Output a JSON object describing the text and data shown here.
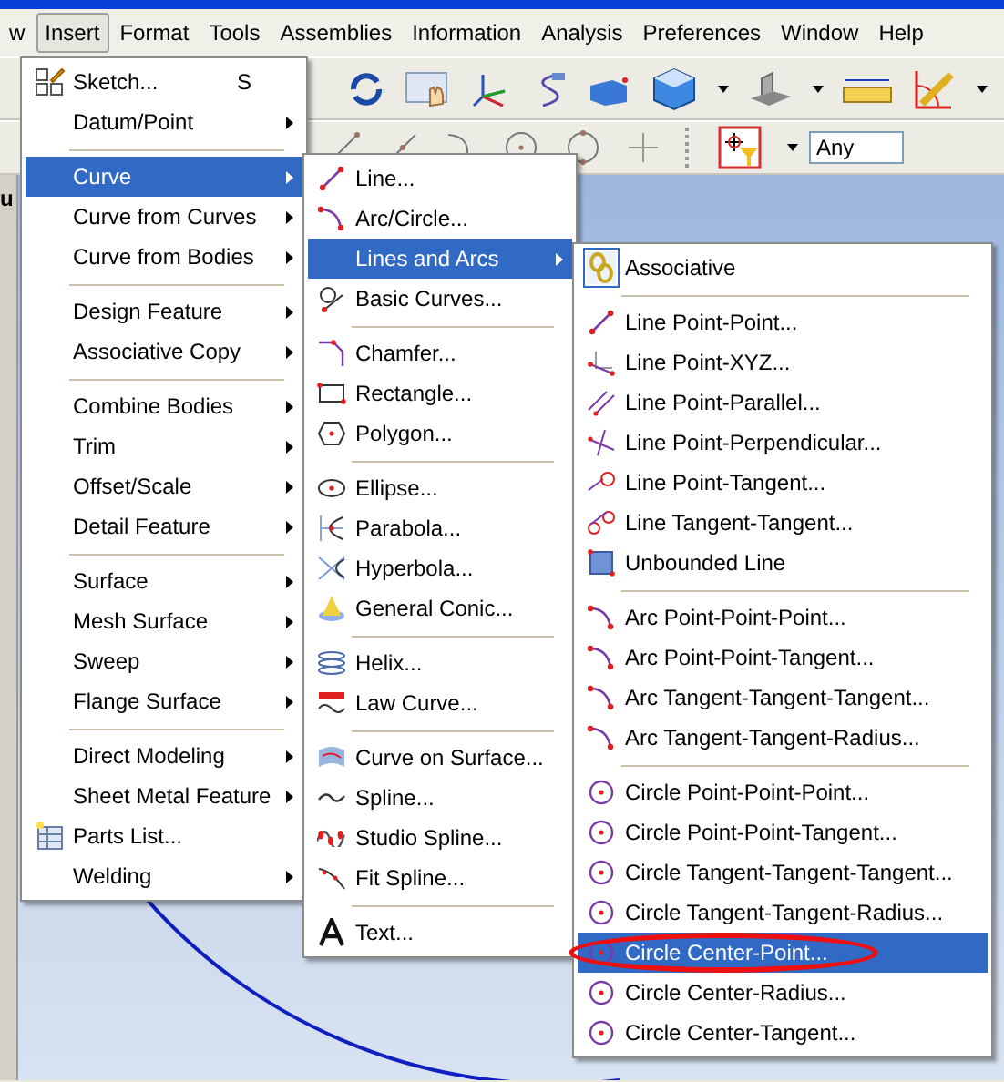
{
  "menubar": [
    {
      "label": "w",
      "selected": false
    },
    {
      "label": "Insert",
      "selected": true
    },
    {
      "label": "Format",
      "selected": false
    },
    {
      "label": "Tools",
      "selected": false
    },
    {
      "label": "Assemblies",
      "selected": false
    },
    {
      "label": "Information",
      "selected": false
    },
    {
      "label": "Analysis",
      "selected": false
    },
    {
      "label": "Preferences",
      "selected": false
    },
    {
      "label": "Window",
      "selected": false
    },
    {
      "label": "Help",
      "selected": false
    }
  ],
  "side_label": "u",
  "toolbar": {
    "selection_filter": {
      "value": "Any"
    }
  },
  "insert_menu": {
    "items": [
      {
        "kind": "item",
        "label": "Sketch...",
        "shortcut": "S",
        "submenu": false,
        "selected": false
      },
      {
        "kind": "item",
        "label": "Datum/Point",
        "submenu": true,
        "selected": false
      },
      {
        "kind": "separator"
      },
      {
        "kind": "item",
        "label": "Curve",
        "submenu": true,
        "selected": true
      },
      {
        "kind": "item",
        "label": "Curve from Curves",
        "submenu": true,
        "selected": false
      },
      {
        "kind": "item",
        "label": "Curve from Bodies",
        "submenu": true,
        "selected": false
      },
      {
        "kind": "separator"
      },
      {
        "kind": "item",
        "label": "Design Feature",
        "submenu": true,
        "selected": false
      },
      {
        "kind": "item",
        "label": "Associative Copy",
        "submenu": true,
        "selected": false
      },
      {
        "kind": "separator"
      },
      {
        "kind": "item",
        "label": "Combine Bodies",
        "submenu": true,
        "selected": false
      },
      {
        "kind": "item",
        "label": "Trim",
        "submenu": true,
        "selected": false
      },
      {
        "kind": "item",
        "label": "Offset/Scale",
        "submenu": true,
        "selected": false
      },
      {
        "kind": "item",
        "label": "Detail Feature",
        "submenu": true,
        "selected": false
      },
      {
        "kind": "separator"
      },
      {
        "kind": "item",
        "label": "Surface",
        "submenu": true,
        "selected": false
      },
      {
        "kind": "item",
        "label": "Mesh Surface",
        "submenu": true,
        "selected": false
      },
      {
        "kind": "item",
        "label": "Sweep",
        "submenu": true,
        "selected": false
      },
      {
        "kind": "item",
        "label": "Flange Surface",
        "submenu": true,
        "selected": false
      },
      {
        "kind": "separator"
      },
      {
        "kind": "item",
        "label": "Direct Modeling",
        "submenu": true,
        "selected": false
      },
      {
        "kind": "item",
        "label": "Sheet Metal Feature",
        "submenu": true,
        "selected": false
      },
      {
        "kind": "item",
        "label": "Parts List...",
        "submenu": false,
        "selected": false
      },
      {
        "kind": "item",
        "label": "Welding",
        "submenu": true,
        "selected": false
      }
    ]
  },
  "curve_menu": {
    "items": [
      {
        "kind": "item",
        "label": "Line...",
        "submenu": false,
        "selected": false
      },
      {
        "kind": "item",
        "label": "Arc/Circle...",
        "submenu": false,
        "selected": false
      },
      {
        "kind": "item",
        "label": "Lines and Arcs",
        "submenu": true,
        "selected": true
      },
      {
        "kind": "item",
        "label": "Basic Curves...",
        "submenu": false,
        "selected": false
      },
      {
        "kind": "separator"
      },
      {
        "kind": "item",
        "label": "Chamfer...",
        "submenu": false,
        "selected": false
      },
      {
        "kind": "item",
        "label": "Rectangle...",
        "submenu": false,
        "selected": false
      },
      {
        "kind": "item",
        "label": "Polygon...",
        "submenu": false,
        "selected": false
      },
      {
        "kind": "separator"
      },
      {
        "kind": "item",
        "label": "Ellipse...",
        "submenu": false,
        "selected": false
      },
      {
        "kind": "item",
        "label": "Parabola...",
        "submenu": false,
        "selected": false
      },
      {
        "kind": "item",
        "label": "Hyperbola...",
        "submenu": false,
        "selected": false
      },
      {
        "kind": "item",
        "label": "General Conic...",
        "submenu": false,
        "selected": false
      },
      {
        "kind": "separator"
      },
      {
        "kind": "item",
        "label": "Helix...",
        "submenu": false,
        "selected": false
      },
      {
        "kind": "item",
        "label": "Law Curve...",
        "submenu": false,
        "selected": false
      },
      {
        "kind": "separator"
      },
      {
        "kind": "item",
        "label": "Curve on Surface...",
        "submenu": false,
        "selected": false
      },
      {
        "kind": "item",
        "label": "Spline...",
        "submenu": false,
        "selected": false
      },
      {
        "kind": "item",
        "label": "Studio Spline...",
        "submenu": false,
        "selected": false
      },
      {
        "kind": "item",
        "label": "Fit Spline...",
        "submenu": false,
        "selected": false
      },
      {
        "kind": "separator"
      },
      {
        "kind": "item",
        "label": "Text...",
        "submenu": false,
        "selected": false
      }
    ]
  },
  "lines_menu": {
    "items": [
      {
        "kind": "toggle",
        "label": "Associative",
        "checked": true,
        "submenu": false,
        "selected": false,
        "circled": false
      },
      {
        "kind": "separator"
      },
      {
        "kind": "item",
        "label": "Line Point-Point...",
        "submenu": false,
        "selected": false,
        "circled": false
      },
      {
        "kind": "item",
        "label": "Line Point-XYZ...",
        "submenu": false,
        "selected": false,
        "circled": false
      },
      {
        "kind": "item",
        "label": "Line Point-Parallel...",
        "submenu": false,
        "selected": false,
        "circled": false
      },
      {
        "kind": "item",
        "label": "Line Point-Perpendicular...",
        "submenu": false,
        "selected": false,
        "circled": false
      },
      {
        "kind": "item",
        "label": "Line Point-Tangent...",
        "submenu": false,
        "selected": false,
        "circled": false
      },
      {
        "kind": "item",
        "label": "Line Tangent-Tangent...",
        "submenu": false,
        "selected": false,
        "circled": false
      },
      {
        "kind": "item",
        "label": "Unbounded Line",
        "submenu": false,
        "selected": false,
        "circled": false
      },
      {
        "kind": "separator"
      },
      {
        "kind": "item",
        "label": "Arc Point-Point-Point...",
        "submenu": false,
        "selected": false,
        "circled": false
      },
      {
        "kind": "item",
        "label": "Arc Point-Point-Tangent...",
        "submenu": false,
        "selected": false,
        "circled": false
      },
      {
        "kind": "item",
        "label": "Arc Tangent-Tangent-Tangent...",
        "submenu": false,
        "selected": false,
        "circled": false
      },
      {
        "kind": "item",
        "label": "Arc Tangent-Tangent-Radius...",
        "submenu": false,
        "selected": false,
        "circled": false
      },
      {
        "kind": "separator"
      },
      {
        "kind": "item",
        "label": "Circle Point-Point-Point...",
        "submenu": false,
        "selected": false,
        "circled": false
      },
      {
        "kind": "item",
        "label": "Circle Point-Point-Tangent...",
        "submenu": false,
        "selected": false,
        "circled": false
      },
      {
        "kind": "item",
        "label": "Circle Tangent-Tangent-Tangent...",
        "submenu": false,
        "selected": false,
        "circled": false
      },
      {
        "kind": "item",
        "label": "Circle Tangent-Tangent-Radius...",
        "submenu": false,
        "selected": false,
        "circled": false
      },
      {
        "kind": "item",
        "label": "Circle Center-Point...",
        "submenu": false,
        "selected": true,
        "circled": true
      },
      {
        "kind": "item",
        "label": "Circle Center-Radius...",
        "submenu": false,
        "selected": false,
        "circled": false
      },
      {
        "kind": "item",
        "label": "Circle Center-Tangent...",
        "submenu": false,
        "selected": false,
        "circled": false
      }
    ]
  }
}
